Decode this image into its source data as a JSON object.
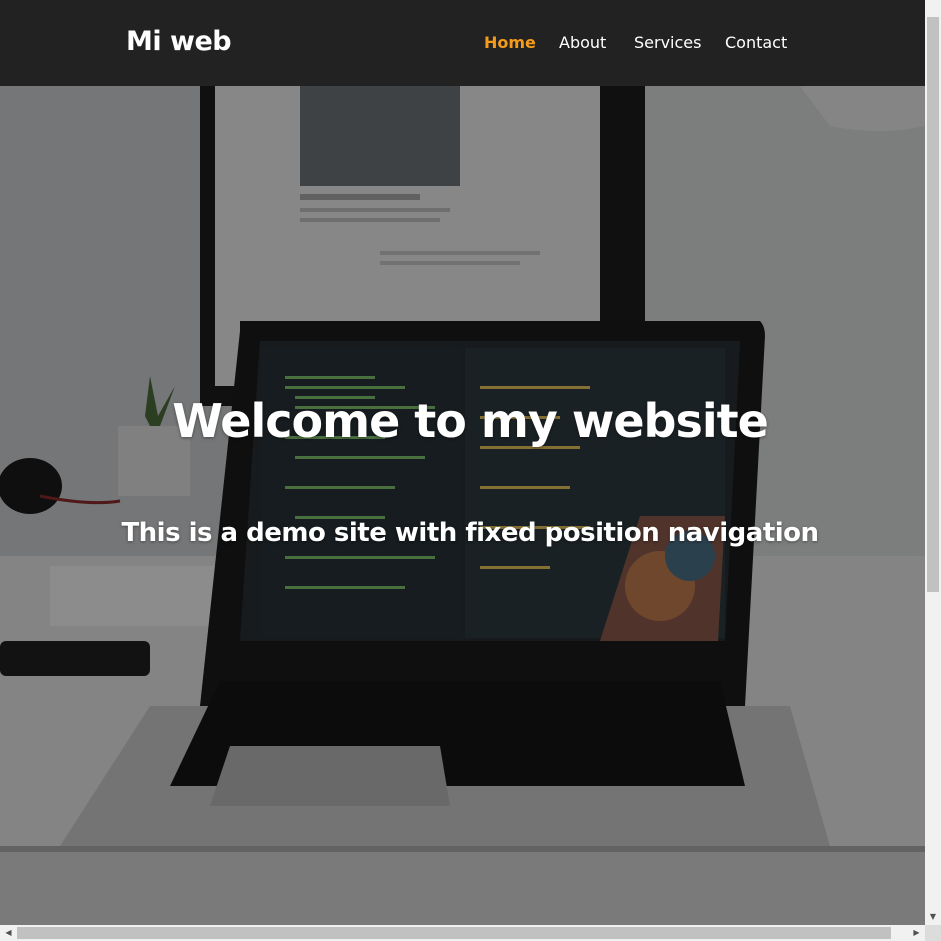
{
  "navbar": {
    "brand": "Mi web",
    "links": [
      {
        "label": "Home",
        "active": true
      },
      {
        "label": "About",
        "active": false
      },
      {
        "label": "Services",
        "active": false
      },
      {
        "label": "Contact",
        "active": false
      }
    ]
  },
  "hero": {
    "title": "Welcome to my website",
    "subtitle": "This is a demo site with fixed position navigation",
    "image_subject": "laptop with code editor on desk"
  },
  "colors": {
    "navbar_bg": "#222222",
    "active_link": "#f49b1a",
    "link": "#ffffff"
  },
  "scrollbars": {
    "up_icon": "arrow-up-icon",
    "down_icon": "arrow-down-icon",
    "left_icon": "arrow-left-icon",
    "right_icon": "arrow-right-icon"
  }
}
